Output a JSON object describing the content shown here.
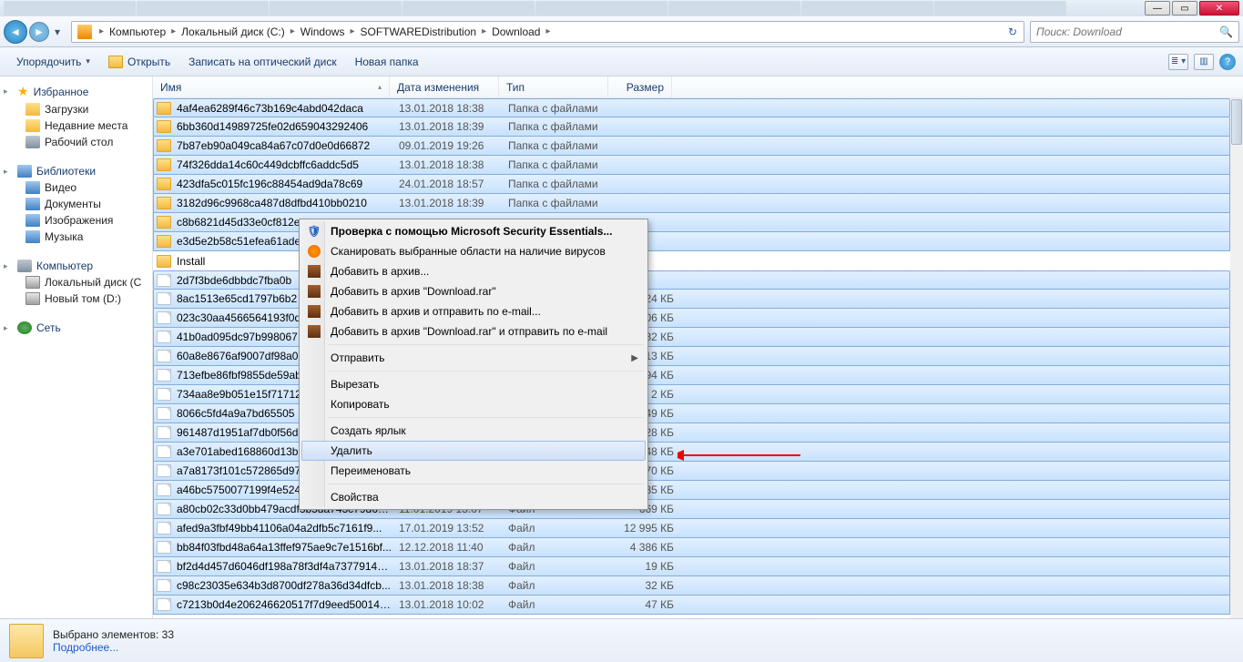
{
  "window": {
    "min": "—",
    "max": "▭",
    "close": "✕"
  },
  "breadcrumb": {
    "segments": [
      "Компьютер",
      "Локальный диск (C:)",
      "Windows",
      "SOFTWAREDistribution",
      "Download"
    ]
  },
  "search": {
    "placeholder": "Поиск: Download"
  },
  "toolbar": {
    "organize": "Упорядочить",
    "open": "Открыть",
    "burn": "Записать на оптический диск",
    "newfolder": "Новая папка"
  },
  "sidebar": {
    "favorites": {
      "label": "Избранное",
      "items": [
        "Загрузки",
        "Недавние места",
        "Рабочий стол"
      ]
    },
    "libraries": {
      "label": "Библиотеки",
      "items": [
        "Видео",
        "Документы",
        "Изображения",
        "Музыка"
      ]
    },
    "computer": {
      "label": "Компьютер",
      "items": [
        "Локальный диск (C",
        "Новый том (D:)"
      ]
    },
    "network": {
      "label": "Сеть"
    }
  },
  "columns": {
    "name": "Имя",
    "date": "Дата изменения",
    "type": "Тип",
    "size": "Размер"
  },
  "files": [
    {
      "i": "folder",
      "n": "4af4ea6289f46c73b169c4abd042daca",
      "d": "13.01.2018 18:38",
      "t": "Папка с файлами",
      "s": "",
      "sel": true
    },
    {
      "i": "folder",
      "n": "6bb360d14989725fe02d659043292406",
      "d": "13.01.2018 18:39",
      "t": "Папка с файлами",
      "s": "",
      "sel": true
    },
    {
      "i": "folder",
      "n": "7b87eb90a049ca84a67c07d0e0d66872",
      "d": "09.01.2019 19:26",
      "t": "Папка с файлами",
      "s": "",
      "sel": true
    },
    {
      "i": "folder",
      "n": "74f326dda14c60c449dcbffc6addc5d5",
      "d": "13.01.2018 18:38",
      "t": "Папка с файлами",
      "s": "",
      "sel": true
    },
    {
      "i": "folder",
      "n": "423dfa5c015fc196c88454ad9da78c69",
      "d": "24.01.2018 18:57",
      "t": "Папка с файлами",
      "s": "",
      "sel": true
    },
    {
      "i": "folder",
      "n": "3182d96c9968ca487d8dfbd410bb0210",
      "d": "13.01.2018 18:39",
      "t": "Папка с файлами",
      "s": "",
      "sel": true
    },
    {
      "i": "folder",
      "n": "c8b6821d45d33e0cf812e",
      "d": "",
      "t": "",
      "s": "",
      "sel": true
    },
    {
      "i": "folder",
      "n": "e3d5e2b58c51efea61ade",
      "d": "",
      "t": "",
      "s": "",
      "sel": true
    },
    {
      "i": "folder",
      "n": "Install",
      "d": "",
      "t": "",
      "s": "",
      "sel": false
    },
    {
      "i": "file",
      "n": "2d7f3bde6dbbdc7fba0b",
      "d": "",
      "t": "",
      "s": "",
      "sel": true
    },
    {
      "i": "file",
      "n": "8ac1513e65cd1797b6b2",
      "d": "",
      "t": "",
      "s": "24 КБ",
      "sel": true
    },
    {
      "i": "file",
      "n": "023c30aa4566564193f0d",
      "d": "",
      "t": "",
      "s": "06 КБ",
      "sel": true
    },
    {
      "i": "file",
      "n": "41b0ad095dc97b998067",
      "d": "",
      "t": "",
      "s": "32 КБ",
      "sel": true
    },
    {
      "i": "file",
      "n": "60a8e8676af9007df98a0",
      "d": "",
      "t": "",
      "s": "13 КБ",
      "sel": true
    },
    {
      "i": "file",
      "n": "713efbe86fbf9855de59ab",
      "d": "",
      "t": "",
      "s": "94 КБ",
      "sel": true
    },
    {
      "i": "file",
      "n": "734aa8e9b051e15f71712e",
      "d": "",
      "t": "",
      "s": "2 КБ",
      "sel": true
    },
    {
      "i": "file",
      "n": "8066c5fd4a9a7bd65505",
      "d": "",
      "t": "",
      "s": "49 КБ",
      "sel": true
    },
    {
      "i": "file",
      "n": "961487d1951af7db0f56d",
      "d": "",
      "t": "",
      "s": "28 КБ",
      "sel": true
    },
    {
      "i": "file",
      "n": "a3e701abed168860d13b",
      "d": "",
      "t": "",
      "s": "48 КБ",
      "sel": true
    },
    {
      "i": "file",
      "n": "a7a8173f101c572865d97",
      "d": "",
      "t": "",
      "s": "70 КБ",
      "sel": true
    },
    {
      "i": "file",
      "n": "a46bc5750077199f4e524",
      "d": "",
      "t": "",
      "s": "35 КБ",
      "sel": true
    },
    {
      "i": "file",
      "n": "a80cb02c33d0bb479acdf3b5da743c79d63...",
      "d": "11.01.2019 13:07",
      "t": "Файл",
      "s": "669 КБ",
      "sel": true
    },
    {
      "i": "file",
      "n": "afed9a3fbf49bb41106a04a2dfb5c7161f9...",
      "d": "17.01.2019 13:52",
      "t": "Файл",
      "s": "12 995 КБ",
      "sel": true
    },
    {
      "i": "file",
      "n": "bb84f03fbd48a64a13ffef975ae9c7e1516bf...",
      "d": "12.12.2018 11:40",
      "t": "Файл",
      "s": "4 386 КБ",
      "sel": true
    },
    {
      "i": "file",
      "n": "bf2d4d457d6046df198a78f3df4a73779142...",
      "d": "13.01.2018 18:37",
      "t": "Файл",
      "s": "19 КБ",
      "sel": true
    },
    {
      "i": "file",
      "n": "c98c23035e634b3d8700df278a36d34dfcb...",
      "d": "13.01.2018 18:38",
      "t": "Файл",
      "s": "32 КБ",
      "sel": true
    },
    {
      "i": "file",
      "n": "c7213b0d4e206246620517f7d9eed50014e55e0f",
      "d": "13.01.2018 10:02",
      "t": "Файл",
      "s": "47 КБ",
      "sel": true
    }
  ],
  "context_menu": {
    "items": [
      {
        "label": "Проверка с помощью Microsoft Security Essentials...",
        "bold": true,
        "icon": "shield"
      },
      {
        "label": "Сканировать выбранные области на наличие вирусов",
        "icon": "av"
      },
      {
        "label": "Добавить в архив...",
        "icon": "rar"
      },
      {
        "label": "Добавить в архив \"Download.rar\"",
        "icon": "rar"
      },
      {
        "label": "Добавить в архив и отправить по e-mail...",
        "icon": "rar"
      },
      {
        "label": "Добавить в архив \"Download.rar\" и отправить по e-mail",
        "icon": "rar"
      },
      {
        "sep": true
      },
      {
        "label": "Отправить",
        "sub": true
      },
      {
        "sep": true
      },
      {
        "label": "Вырезать"
      },
      {
        "label": "Копировать"
      },
      {
        "sep": true
      },
      {
        "label": "Создать ярлык"
      },
      {
        "label": "Удалить",
        "hl": true
      },
      {
        "label": "Переименовать"
      },
      {
        "sep": true
      },
      {
        "label": "Свойства"
      }
    ]
  },
  "statusbar": {
    "line1": "Выбрано элементов: 33",
    "line2": "Подробнее..."
  }
}
